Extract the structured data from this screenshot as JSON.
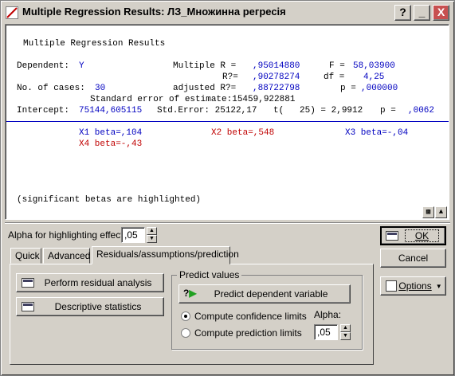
{
  "window": {
    "title": "Multiple Regression Results: ЛЗ_Множинна регресія",
    "help_btn": "?",
    "min_btn": "_",
    "close_btn": "X"
  },
  "output": {
    "header": "Multiple Regression Results",
    "dependent_label": "Dependent:",
    "dependent_value": "Y",
    "multiple_r_label": "Multiple R =",
    "multiple_r_value": ",95014880",
    "f_label": "F =",
    "f_value": "58,03900",
    "r2_label": "R?=",
    "r2_value": ",90278274",
    "df_label": "df =",
    "df_value": "4,25",
    "cases_label": "No. of cases:",
    "cases_value": "30",
    "adj_r2_label": "adjusted R?=",
    "adj_r2_value": ",88722798",
    "p_label": "p =",
    "p_value": ",000000",
    "std_err_est": "Standard error of estimate:15459,922881",
    "intercept_label": "Intercept:",
    "intercept_value": "75144,605115",
    "intercept_se": "Std.Error: 25122,17",
    "intercept_t": "t(   25) = 2,9912",
    "intercept_p_label": "p =",
    "intercept_p_value": ",0062",
    "beta1": "X1 beta=,104",
    "beta2": "X2 beta=,548",
    "beta3": "X3 beta=-,04",
    "beta4": "X4 beta=-,43",
    "note": "(significant betas are highlighted)"
  },
  "alpha_effects": {
    "label": "Alpha for highlighting effects:",
    "value": ",05"
  },
  "tabs": [
    {
      "label": "Quick"
    },
    {
      "label": "Advanced"
    },
    {
      "label": "Residuals/assumptions/prediction"
    }
  ],
  "buttons": {
    "perform_residual": "Perform residual analysis",
    "descriptive": "Descriptive statistics",
    "ok": "OK",
    "cancel": "Cancel",
    "options": "Options",
    "predict_dependent": "Predict dependent variable"
  },
  "predict": {
    "group_title": "Predict values",
    "confidence": "Compute confidence limits",
    "prediction": "Compute prediction limits",
    "alpha_label": "Alpha:",
    "alpha_value": ",05"
  },
  "colors": {
    "significant": "#c00000",
    "normal": "#0000c0",
    "face": "#d4d0c8"
  }
}
